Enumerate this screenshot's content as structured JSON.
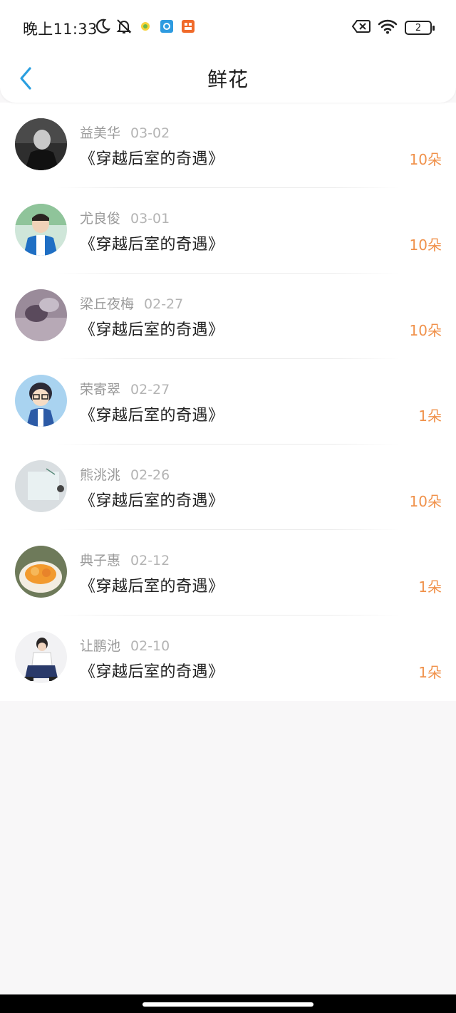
{
  "status_bar": {
    "time": "晚上11:33",
    "icons_left": [
      "moon-icon",
      "bell-off-icon",
      "app-notification-icon-yellow",
      "app-notification-icon-blue",
      "app-notification-icon-orange"
    ],
    "icons_right": [
      "sim-disabled-icon",
      "wifi-icon",
      "battery-icon"
    ],
    "battery_level": "2"
  },
  "header": {
    "back_icon": "chevron-left-icon",
    "title": "鲜花"
  },
  "colors": {
    "accent_back": "#2a9fe0",
    "amount": "#f0914a",
    "page_bg": "#f8f7f8"
  },
  "items": [
    {
      "name": "益美华",
      "date": "03-02",
      "title": "《穿越后室的奇遇》",
      "amount": "10朵"
    },
    {
      "name": "尤良俊",
      "date": "03-01",
      "title": "《穿越后室的奇遇》",
      "amount": "10朵"
    },
    {
      "name": "梁丘夜梅",
      "date": "02-27",
      "title": "《穿越后室的奇遇》",
      "amount": "10朵"
    },
    {
      "name": "荣寄翠",
      "date": "02-27",
      "title": "《穿越后室的奇遇》",
      "amount": "1朵"
    },
    {
      "name": "熊洮洮",
      "date": "02-26",
      "title": "《穿越后室的奇遇》",
      "amount": "10朵"
    },
    {
      "name": "典子惠",
      "date": "02-12",
      "title": "《穿越后室的奇遇》",
      "amount": "1朵"
    },
    {
      "name": "让鹏池",
      "date": "02-10",
      "title": "《穿越后室的奇遇》",
      "amount": "1朵"
    }
  ]
}
